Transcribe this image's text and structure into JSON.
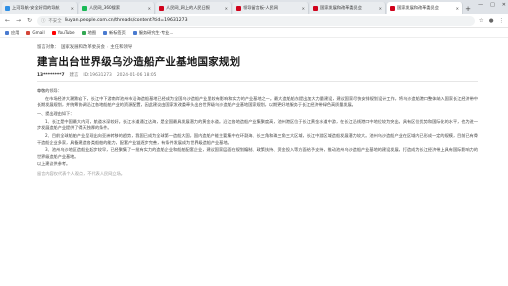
{
  "browser": {
    "tabs": [
      {
        "title": "上河导航-安全好用的导航",
        "favicon_color": "#2f8fe5",
        "active": false
      },
      {
        "title": "人民网_360搜索",
        "favicon_color": "#19b955",
        "active": false
      },
      {
        "title": "人民网_网上的人民日报",
        "favicon_color": "#d0021b",
        "active": false
      },
      {
        "title": "领导留言板-人民网",
        "favicon_color": "#d0021b",
        "active": false
      },
      {
        "title": "国家发展和改革委员会",
        "favicon_color": "#d0021b",
        "active": false
      },
      {
        "title": "国家发展和改革委员会",
        "favicon_color": "#d0021b",
        "active": true
      }
    ],
    "new_tab": "+",
    "window_controls": [
      "—",
      "□",
      "✕"
    ],
    "address": {
      "security": "不安全",
      "url": "liuyan.people.com.cn/threads/content?tid=19631273"
    },
    "bookmarks": [
      {
        "label": "应用",
        "color": "#4a7bd0"
      },
      {
        "label": "Gmail",
        "color": "#d44638"
      },
      {
        "label": "YouTube",
        "color": "#ff0000"
      },
      {
        "label": "地图",
        "color": "#34a853"
      },
      {
        "label": "新标签页",
        "color": "#4a7bd0"
      },
      {
        "label": "服务研究生·专业...",
        "color": "#4a7bd0"
      }
    ]
  },
  "page": {
    "breadcrumb": [
      "留言对象：",
      "国家发展和改革委员会",
      "主任和领导"
    ],
    "title": "建言出台世界级乌沙造船产业基地国家规划",
    "meta": {
      "author": "13********7",
      "tag": "建言",
      "id": "ID:19631273",
      "date": "2024-01-06 18:05"
    },
    "paragraphs": [
      {
        "text": "尊敬的领导：",
        "style": ""
      },
      {
        "text": "在市场经济大潮跌宕下，长江中下游南岸池州市沿海造船基地已经成为全国乌沙造船产业里较有影响和实力的产业基地之一。最大造船船东提出加大力量建设，建议国家尽快安排规划设计工作，将乌沙造船港口整体纳入国家长江经济带中长期发展规划，并统筹协调沿江各地船舶产业的资源配置，因此建议由国家发改委牵头出台世界级乌沙造船产业基地国家规划，以期更好地服务于长江经济带绿色高质量发展。",
        "style": "indent"
      },
      {
        "text": "一、提出理由如下：",
        "style": "gap"
      },
      {
        "text": "1、长江是中国最大内河，航道水深较好。长江水道通江达海，是全国最具发展潜力的黄金水道。沿江各地造船产业集聚度高，池州港区位于长江黄金水道中游，在长江沿线港口中地位较为突出，具有区位优势和国际化的水平，也为进一步发展造船产业提供了得天独厚的条件。",
        "style": "indent"
      },
      {
        "text": "2、目前全球船舶产业呈现出向亚洲转移的趋势，我国已成为全球第一造船大国，国内造船产能主要集中在环渤海、长三角和珠三角三大区域，长江中游区域造船发展潜力较大。池州乌沙造船产业在区域内已形成一定的规模，目前已有骨干造船企业多家，具备建造各类船舶的能力，配套产业链逐步完善，有条件发展成为世界级造船产业基地。",
        "style": "indent"
      },
      {
        "text": "3、池州乌沙地区造船业起步较早，已经聚集了一批有实力的造船企业和船舶配套企业，建议国家层面在规划编制、政策扶持、资金投入等方面给予支持，推动池州乌沙造船产业基地的建设发展，打造成为长江经济带上具有国际影响力的世界级造船产业基地。",
        "style": "indent"
      },
      {
        "text": "以上建议供参考。",
        "style": ""
      }
    ],
    "footnote": "留言内容仅代表个人观点，不代表人民网立场。"
  }
}
